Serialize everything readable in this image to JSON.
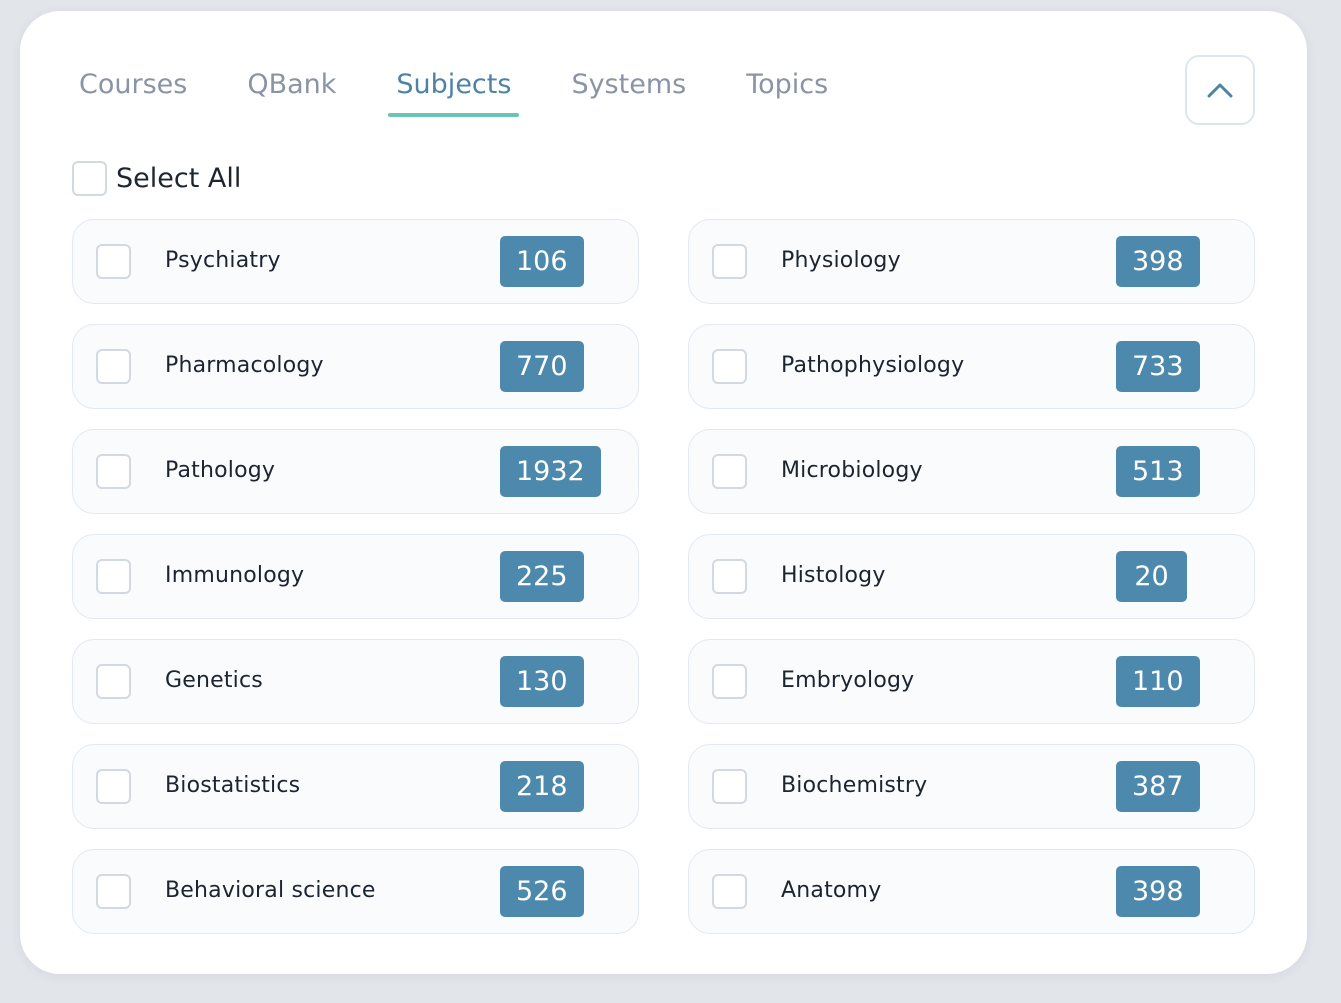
{
  "tabs": [
    {
      "label": "Courses",
      "active": false
    },
    {
      "label": "QBank",
      "active": false
    },
    {
      "label": "Subjects",
      "active": true
    },
    {
      "label": "Systems",
      "active": false
    },
    {
      "label": "Topics",
      "active": false
    }
  ],
  "collapse_icon": "chevron-up-icon",
  "select_all": {
    "label": "Select All",
    "checked": false
  },
  "colors": {
    "accent_text": "#4f83a6",
    "tab_underline": "#6cc4b6",
    "count_badge": "#4d89ad"
  },
  "subjects": [
    {
      "name": "Psychiatry",
      "count": "106",
      "checked": false
    },
    {
      "name": "Physiology",
      "count": "398",
      "checked": false
    },
    {
      "name": "Pharmacology",
      "count": "770",
      "checked": false
    },
    {
      "name": "Pathophysiology",
      "count": "733",
      "checked": false
    },
    {
      "name": "Pathology",
      "count": "1932",
      "checked": false
    },
    {
      "name": "Microbiology",
      "count": "513",
      "checked": false
    },
    {
      "name": "Immunology",
      "count": "225",
      "checked": false
    },
    {
      "name": "Histology",
      "count": "20",
      "checked": false
    },
    {
      "name": "Genetics",
      "count": "130",
      "checked": false
    },
    {
      "name": "Embryology",
      "count": "110",
      "checked": false
    },
    {
      "name": "Biostatistics",
      "count": "218",
      "checked": false
    },
    {
      "name": "Biochemistry",
      "count": "387",
      "checked": false
    },
    {
      "name": "Behavioral science",
      "count": "526",
      "checked": false
    },
    {
      "name": "Anatomy",
      "count": "398",
      "checked": false
    }
  ]
}
